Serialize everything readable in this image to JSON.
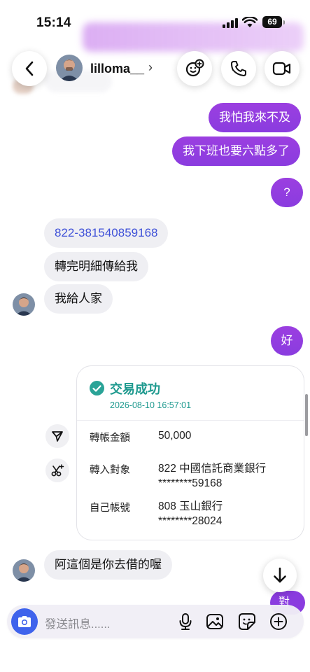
{
  "status_bar": {
    "time": "15:14",
    "battery": "69"
  },
  "header": {
    "username": "lilloma__",
    "chevron": "›"
  },
  "messages": [
    {
      "dir": "out",
      "text": "我怕我來不及"
    },
    {
      "dir": "out",
      "text": "我下班也要六點多了"
    },
    {
      "dir": "out",
      "text": "?"
    },
    {
      "dir": "in",
      "text": "822-381540859168"
    },
    {
      "dir": "in",
      "text": "轉完明細傳給我"
    },
    {
      "dir": "in",
      "text": "我給人家"
    },
    {
      "dir": "out",
      "text": "好"
    },
    {
      "dir": "in",
      "text": "阿這個是你去借的喔"
    }
  ],
  "receipt": {
    "status": "交易成功",
    "timestamp": "2026-08-10 16:57:01",
    "amount_label": "轉帳金額",
    "amount": "50,000",
    "to_label": "轉入對象",
    "to_bank": "822 中國信託商業銀行",
    "to_account": "********59168",
    "from_label": "自己帳號",
    "from_bank": "808 玉山銀行",
    "from_account": "********28024"
  },
  "peek_bubble": "對",
  "composer": {
    "placeholder": "發送訊息......"
  },
  "colors": {
    "outgoing": "#8a3cdf",
    "incoming": "#efeff3",
    "success": "#1f9a8f",
    "link": "#3f51d8",
    "camera": "#3f63ec"
  }
}
